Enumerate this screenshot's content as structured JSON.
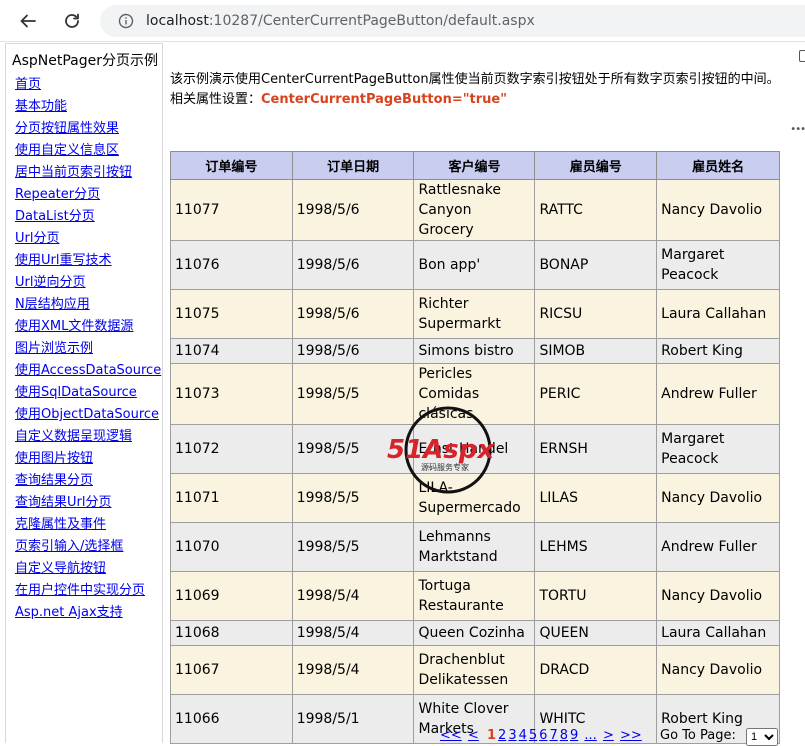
{
  "browser": {
    "url_host": "localhost",
    "url_path": ":10287/CenterCurrentPageButton/default.aspx"
  },
  "sidebar": {
    "title": "AspNetPager分页示例",
    "items": [
      {
        "label": "首页"
      },
      {
        "label": "基本功能"
      },
      {
        "label": "分页按钮属性效果"
      },
      {
        "label": "使用自定义信息区"
      },
      {
        "label": "居中当前页索引按钮"
      },
      {
        "label": "Repeater分页"
      },
      {
        "label": "DataList分页"
      },
      {
        "label": "Url分页"
      },
      {
        "label": "使用Url重写技术"
      },
      {
        "label": "Url逆向分页"
      },
      {
        "label": "N层结构应用"
      },
      {
        "label": "使用XML文件数据源"
      },
      {
        "label": "图片浏览示例"
      },
      {
        "label": "使用AccessDataSource"
      },
      {
        "label": "使用SqlDataSource"
      },
      {
        "label": "使用ObjectDataSource"
      },
      {
        "label": "自定义数据呈现逻辑"
      },
      {
        "label": "使用图片按钮"
      },
      {
        "label": "查询结果分页"
      },
      {
        "label": "查询结果Url分页"
      },
      {
        "label": "克隆属性及事件"
      },
      {
        "label": "页索引输入/选择框"
      },
      {
        "label": "自定义导航按钮"
      },
      {
        "label": "在用户控件中实现分页"
      },
      {
        "label": "Asp.net Ajax支持"
      }
    ]
  },
  "main": {
    "description": "该示例演示使用CenterCurrentPageButton属性使当前页数字索引按钮处于所有数字页索引按钮的中间。",
    "prop_label": "相关属性设置：",
    "prop_value": "CenterCurrentPageButton=\"true\""
  },
  "table": {
    "headers": [
      "订单编号",
      "订单日期",
      "客户编号",
      "雇员编号",
      "雇员姓名"
    ],
    "rows": [
      [
        "11077",
        "1998/5/6",
        "Rattlesnake Canyon Grocery",
        "RATTC",
        "Nancy Davolio"
      ],
      [
        "11076",
        "1998/5/6",
        "Bon app'",
        "BONAP",
        "Margaret Peacock"
      ],
      [
        "11075",
        "1998/5/6",
        "Richter Supermarkt",
        "RICSU",
        "Laura Callahan"
      ],
      [
        "11074",
        "1998/5/6",
        "Simons bistro",
        "SIMOB",
        "Robert King"
      ],
      [
        "11073",
        "1998/5/5",
        "Pericles Comidas clásicas",
        "PERIC",
        "Andrew Fuller"
      ],
      [
        "11072",
        "1998/5/5",
        "Ernst Handel",
        "ERNSH",
        "Margaret Peacock"
      ],
      [
        "11071",
        "1998/5/5",
        "LILA-Supermercado",
        "LILAS",
        "Nancy Davolio"
      ],
      [
        "11070",
        "1998/5/5",
        "Lehmanns Marktstand",
        "LEHMS",
        "Andrew Fuller"
      ],
      [
        "11069",
        "1998/5/4",
        "Tortuga Restaurante",
        "TORTU",
        "Nancy Davolio"
      ],
      [
        "11068",
        "1998/5/4",
        "Queen Cozinha",
        "QUEEN",
        "Laura Callahan"
      ],
      [
        "11067",
        "1998/5/4",
        "Drachenblut Delikatessen",
        "DRACD",
        "Nancy Davolio"
      ],
      [
        "11066",
        "1998/5/1",
        "White Clover Markets",
        "WHITC",
        "Robert King"
      ]
    ]
  },
  "watermark": {
    "brand": "51Aspx",
    "tagline": "源码服务专家"
  },
  "pager": {
    "first": "<<",
    "prev": "<",
    "current": "1",
    "pages": [
      "2",
      "3",
      "4",
      "5",
      "6",
      "7",
      "8",
      "9"
    ],
    "ellipsis": "...",
    "next": ">",
    "last": ">>",
    "goto_label": "Go To Page:",
    "goto_value": "1"
  },
  "colors": {
    "link": "#0000ee",
    "accent": "#d9431e",
    "header_bg": "#c9cdf0",
    "row_odd": "#faf3df",
    "row_even": "#ececec"
  }
}
